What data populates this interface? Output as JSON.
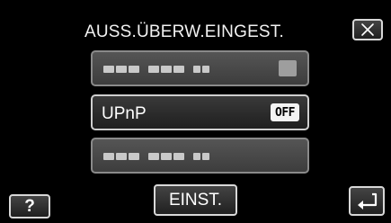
{
  "screen": {
    "title": "AUSS.ÜBERW.EINGEST.",
    "close_icon": "close-icon",
    "help_label": "?",
    "back_icon": "back-arrow-icon",
    "set_button_label": "EINST."
  },
  "rows": [
    {
      "kind": "masked",
      "state": "disabled",
      "value_mask": "███ ███ ██",
      "right_icon": "lock-icon"
    },
    {
      "kind": "toggle",
      "label": "UPnP",
      "value": "OFF"
    },
    {
      "kind": "masked",
      "state": "disabled",
      "value_mask": "███ ███ ██"
    }
  ]
}
